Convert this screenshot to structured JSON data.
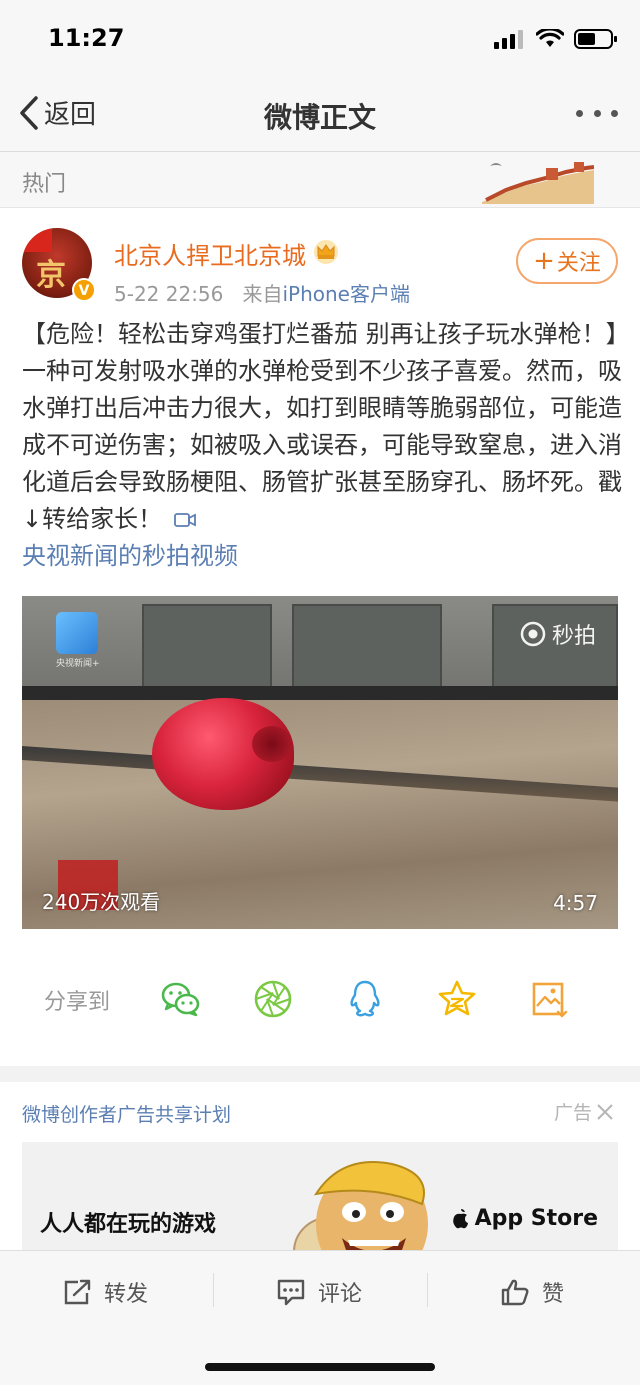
{
  "status": {
    "time": "11:27"
  },
  "nav": {
    "back_label": "返回",
    "title": "微博正文"
  },
  "hot": {
    "label": "热门"
  },
  "post": {
    "username": "北京人捍卫北京城",
    "time": "5-22 22:56",
    "from_prefix": "来自",
    "source": "iPhone客户端",
    "follow_label": "关注",
    "text": "【危险！轻松击穿鸡蛋打烂番茄 别再让孩子玩水弹枪！】一种可发射吸水弹的水弹枪受到不少孩子喜爱。然而，吸水弹打出后冲击力很大，如打到眼睛等脆弱部位，可能造成不可逆伤害；如被吸入或误吞，可能导致窒息，进入消化道后会导致肠梗阻、肠管扩张甚至肠穿孔、肠坏死。戳↓转给家长！",
    "video_link": "央视新闻的秒拍视频",
    "video": {
      "logo_text": "央视新闻+",
      "brand": "秒拍",
      "views": "240万次观看",
      "duration": "4:57"
    }
  },
  "share": {
    "label": "分享到",
    "icons": [
      "wechat-icon",
      "moments-icon",
      "qq-icon",
      "qzone-icon",
      "save-image-icon"
    ],
    "colors": {
      "wechat": "#4bb84d",
      "moments": "#7ac943",
      "qq": "#3aa0e0",
      "qzone": "#f5b800",
      "save": "#f0a43a"
    }
  },
  "ad": {
    "header": "微博创作者广告共享计划",
    "tag": "广告",
    "title": "人人都在玩的游戏",
    "store": "App Store"
  },
  "actions": {
    "repost": "转发",
    "comment": "评论",
    "like": "赞"
  },
  "colors": {
    "accent_orange": "#e86b1f",
    "link_blue": "#5b7fb3"
  }
}
